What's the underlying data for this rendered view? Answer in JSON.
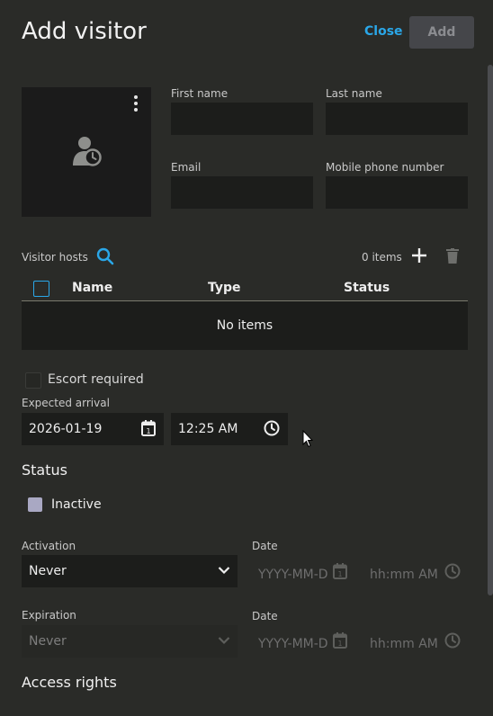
{
  "dialog": {
    "title": "Add visitor",
    "close_label": "Close",
    "add_label": "Add"
  },
  "fields": {
    "first_name_label": "First name",
    "last_name_label": "Last name",
    "email_label": "Email",
    "mobile_label": "Mobile phone number"
  },
  "hosts": {
    "label": "Visitor hosts",
    "count": "0 items",
    "columns": [
      "Name",
      "Type",
      "Status"
    ],
    "empty": "No items"
  },
  "escort": {
    "label": "Escort required"
  },
  "arrival": {
    "label": "Expected arrival",
    "date": "2026-01-19",
    "time": "12:25 AM"
  },
  "status": {
    "heading": "Status",
    "value": "Inactive"
  },
  "activation": {
    "label": "Activation",
    "value": "Never",
    "date_label": "Date",
    "date_placeholder": "YYYY-MM-D",
    "time_placeholder": "hh:mm AM"
  },
  "expiration": {
    "label": "Expiration",
    "value": "Never",
    "date_label": "Date",
    "date_placeholder": "YYYY-MM-D",
    "time_placeholder": "hh:mm AM"
  },
  "access_rights": {
    "heading": "Access rights"
  },
  "colors": {
    "accent": "#2aa7e8",
    "background": "#2a2b28",
    "field": "#1c1d1b"
  },
  "icons": [
    "kebab-menu-icon",
    "visitor-icon",
    "search-icon",
    "plus-icon",
    "trash-icon",
    "calendar-icon",
    "clock-icon",
    "chevron-down-icon",
    "mouse-cursor-icon"
  ]
}
